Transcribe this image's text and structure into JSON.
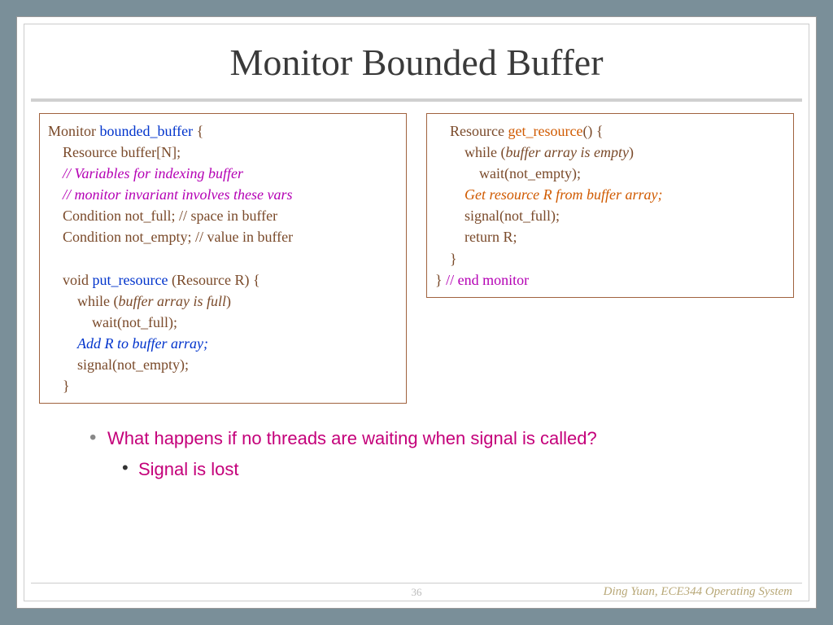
{
  "title": "Monitor Bounded Buffer",
  "left": {
    "l1a": "Monitor ",
    "l1b": "bounded_buffer ",
    "l1c": "{",
    "l2": "Resource buffer[N];",
    "l3": "//  Variables for indexing buffer",
    "l4": "// monitor invariant involves these vars",
    "l5": "Condition not_full; // space in buffer",
    "l6": "Condition not_empty; // value in buffer",
    "l7a": "void ",
    "l7b": "put_resource ",
    "l7c": "(Resource R) {",
    "l8a": "while (",
    "l8b": "buffer array is full",
    "l8c": ")",
    "l9": "wait(not_full);",
    "l10": "Add R to buffer array;",
    "l11": "signal(not_empty);",
    "l12": "}"
  },
  "right": {
    "l1a": "Resource ",
    "l1b": "get_resource",
    "l1c": "() {",
    "l2a": "while (",
    "l2b": "buffer array is empty",
    "l2c": ")",
    "l3": "wait(not_empty);",
    "l4": "Get resource R from buffer array;",
    "l5": "signal(not_full);",
    "l6": "return R;",
    "l7": "}",
    "l8a": "}",
    "l8b": " // end monitor"
  },
  "bullets": {
    "q": "What happens if no threads are waiting when signal is called?",
    "a": "Signal is lost"
  },
  "footer": {
    "page": "36",
    "credit": "Ding Yuan, ECE344 Operating System"
  }
}
